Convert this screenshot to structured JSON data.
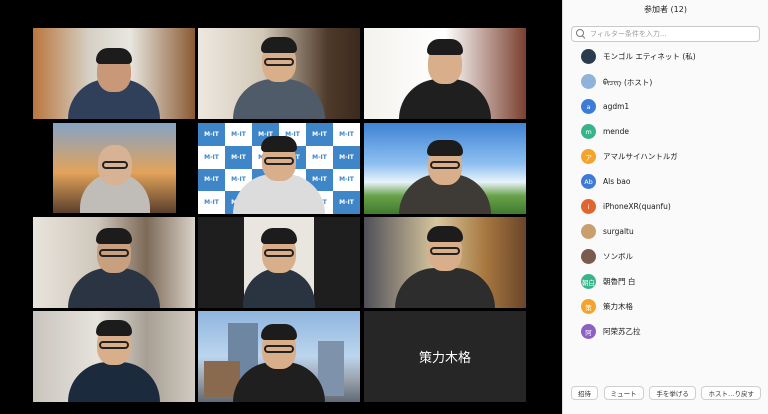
{
  "panel": {
    "title": "参加者 (12)",
    "filter_placeholder": "フィルター条件を入力..."
  },
  "participants": [
    {
      "name": "モンゴル エティネット (私)",
      "avatar_text": "",
      "avatar_color": "#2a3b4d"
    },
    {
      "name": "ᠪᠢᠴᠢᠭ (ホスト)",
      "avatar_text": "",
      "avatar_color": "#8fb3d9"
    },
    {
      "name": "agdm1",
      "avatar_text": "a",
      "avatar_color": "#3d7bd6"
    },
    {
      "name": "mende",
      "avatar_text": "m",
      "avatar_color": "#38b48b"
    },
    {
      "name": "アマルサイハントルガ",
      "avatar_text": "ア",
      "avatar_color": "#f3a42c"
    },
    {
      "name": "Als bao",
      "avatar_text": "Ab",
      "avatar_color": "#3d7bd6"
    },
    {
      "name": "iPhoneXR(quanfu)",
      "avatar_text": "i",
      "avatar_color": "#e0662d"
    },
    {
      "name": "surgaltu",
      "avatar_text": "",
      "avatar_color": "#c9a06b"
    },
    {
      "name": "ソンボル",
      "avatar_text": "",
      "avatar_color": "#7a5b4d"
    },
    {
      "name": "朝魯門 白",
      "avatar_text": "朝白",
      "avatar_color": "#38b48b"
    },
    {
      "name": "策力木格",
      "avatar_text": "策",
      "avatar_color": "#f3a42c"
    },
    {
      "name": "阿荣苏乙拉",
      "avatar_text": "阿",
      "avatar_color": "#8e5fc4"
    }
  ],
  "footer": {
    "invite": "招待",
    "mute_all": "ミュート",
    "raise_hand": "手を挙げる",
    "reclaim_host": "ホスト…り戻す"
  },
  "gallery": {
    "name_only_tile": "策力木格",
    "logo_text": "M-IT"
  }
}
